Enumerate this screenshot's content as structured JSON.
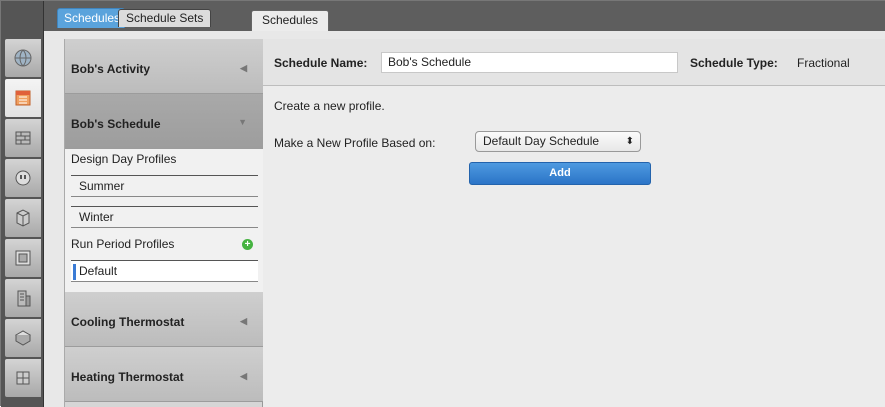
{
  "top_tabs": [
    "Schedules",
    "Schedule Sets",
    "Schedules"
  ],
  "sidebar": {
    "groups": [
      {
        "label": "Bob's Activity",
        "arrow": "◀"
      },
      {
        "label": "Bob's Schedule",
        "arrow": "▼"
      },
      {
        "label": "Cooling Thermostat",
        "arrow": "◀"
      },
      {
        "label": "Heating Thermostat",
        "arrow": "◀"
      }
    ],
    "design_day_label": "Design Day Profiles",
    "design_day_items": [
      "Summer",
      "Winter"
    ],
    "run_period_label": "Run Period Profiles",
    "run_period_items": [
      "Default"
    ],
    "add_icon": "+"
  },
  "main": {
    "schedule_name_label": "Schedule Name:",
    "schedule_name_value": "Bob's Schedule",
    "schedule_type_label": "Schedule Type:",
    "schedule_type_value": "Fractional",
    "create_text": "Create a new profile.",
    "based_on_label": "Make a New Profile Based on:",
    "based_on_value": "Default Day Schedule",
    "select_chevron": "⬍",
    "add_button": "Add"
  },
  "colors": {
    "accent_blue": "#2b74c7",
    "active_tab": "#5aa3dc",
    "add_green": "#46b341"
  },
  "icons": [
    "site-globe-icon",
    "schedules-calendar-icon",
    "constructions-icon",
    "loads-outlet-icon",
    "space-types-icon",
    "geometry-icon",
    "facility-building-icon",
    "spaces-icon",
    "thermal-zones-icon"
  ]
}
